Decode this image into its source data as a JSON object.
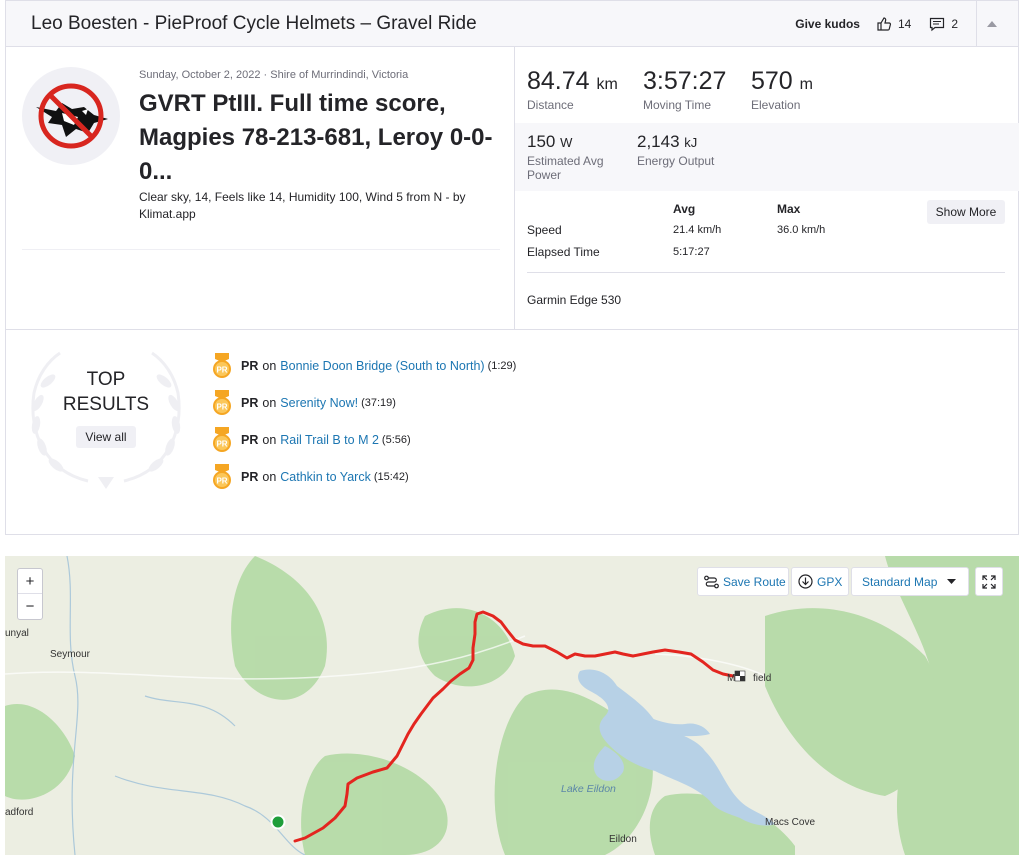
{
  "header": {
    "title": "Leo Boesten - PieProof Cycle Helmets – Gravel Ride",
    "give_kudos": "Give kudos",
    "kudos_count": "14",
    "comment_count": "2"
  },
  "activity": {
    "date_location": "Sunday, October 2, 2022 · Shire of Murrindindi, Victoria",
    "title": "GVRT PtIII. Full time score, Magpies 78-213-681, Leroy 0-0-0...",
    "description": "Clear sky, 14, Feels like 14, Humidity 100, Wind 5 from N - by Klimat.app"
  },
  "stats": {
    "distance": {
      "value": "84.74",
      "unit": "km",
      "label": "Distance"
    },
    "moving_time": {
      "value": "3:57:27",
      "label": "Moving Time"
    },
    "elevation": {
      "value": "570",
      "unit": "m",
      "label": "Elevation"
    },
    "power": {
      "value": "150",
      "unit": "W",
      "label_line1": "Estimated Avg",
      "label_line2": "Power"
    },
    "energy": {
      "value": "2,143",
      "unit": "kJ",
      "label": "Energy Output"
    }
  },
  "table": {
    "col_avg": "Avg",
    "col_max": "Max",
    "show_more": "Show More",
    "rows": [
      {
        "label": "Speed",
        "avg": "21.4 km/h",
        "max": "36.0 km/h"
      },
      {
        "label": "Elapsed Time",
        "avg": "5:17:27",
        "max": ""
      }
    ],
    "device": "Garmin Edge 530"
  },
  "top_results": {
    "line1": "TOP",
    "line2": "RESULTS",
    "view_all": "View all",
    "items": [
      {
        "badge": "PR",
        "on": "on",
        "segment": "Bonnie Doon Bridge (South to North)",
        "time": "(1:29)"
      },
      {
        "badge": "PR",
        "on": "on",
        "segment": "Serenity Now!",
        "time": "(37:19)"
      },
      {
        "badge": "PR",
        "on": "on",
        "segment": "Rail Trail B to M 2",
        "time": "(5:56)"
      },
      {
        "badge": "PR",
        "on": "on",
        "segment": "Cathkin to Yarck",
        "time": "(15:42)"
      }
    ]
  },
  "map": {
    "zoom_in": "+",
    "zoom_out": "−",
    "save_route": "Save Route",
    "gpx": "GPX",
    "map_style": "Standard Map",
    "labels": {
      "nunyal": "unyal",
      "seymour": "Seymour",
      "radford": "adford",
      "lake_eildon": "Lake Eildon",
      "eildon": "Eildon",
      "macs_cove": "Macs Cove",
      "mansfield_a": "M",
      "mansfield_b": "field"
    },
    "colors": {
      "route": "#e3251f",
      "start": "#1f9e3a",
      "water": "#b9d3e8",
      "forest": "#a9d49a"
    }
  }
}
